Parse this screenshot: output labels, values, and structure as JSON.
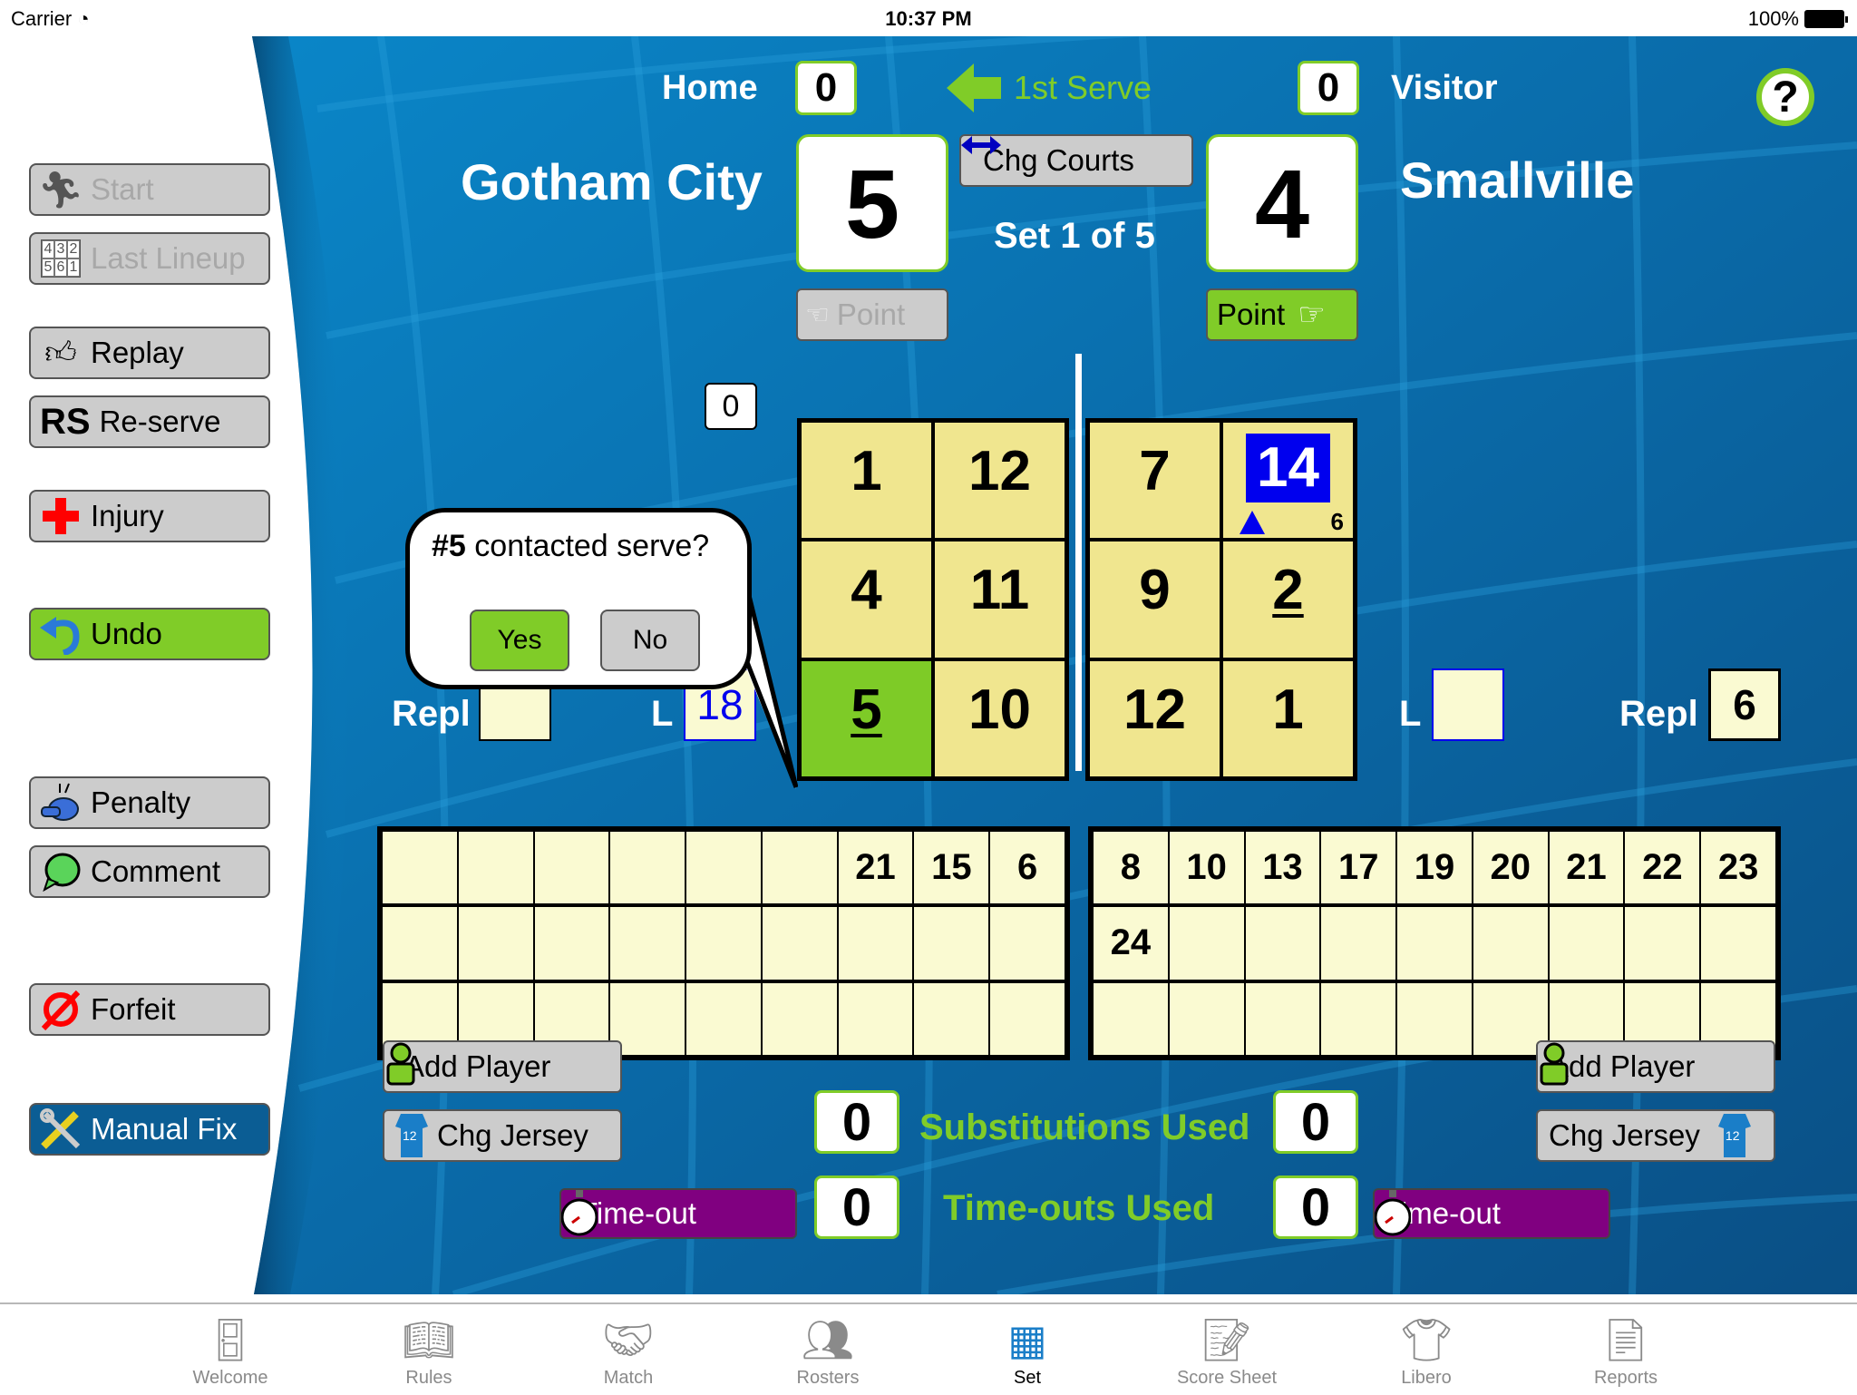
{
  "status_bar": {
    "carrier": "Carrier",
    "time": "10:37 PM",
    "battery": "100%"
  },
  "sidebar": {
    "start": "Start",
    "last_lineup": "Last Lineup",
    "last_lineup_icon_digits": [
      "4",
      "3",
      "2",
      "5",
      "6",
      "1"
    ],
    "replay": "Replay",
    "reserve_icon": "RS",
    "reserve": "Re-serve",
    "injury": "Injury",
    "undo": "Undo",
    "penalty": "Penalty",
    "comment": "Comment",
    "forfeit": "Forfeit",
    "manual_fix": "Manual Fix"
  },
  "header": {
    "home_label": "Home",
    "home_sets": "0",
    "visitor_label": "Visitor",
    "visitor_sets": "0",
    "first_serve": "1st Serve",
    "help": "?",
    "home_team": "Gotham City",
    "visitor_team": "Smallville",
    "home_score": "5",
    "visitor_score": "4",
    "change_courts": "Chg Courts",
    "set_info": "Set 1 of 5",
    "home_point": "Point",
    "visitor_point": "Point"
  },
  "home_court": {
    "serve_counter": "0",
    "cells": [
      "1",
      "12",
      "4",
      "11",
      "5",
      "10"
    ],
    "repl_label": "Repl",
    "repl_value": "",
    "libero_label": "L",
    "libero_value": "18"
  },
  "visitor_court": {
    "cells": [
      "7",
      "14",
      "9",
      "2",
      "12",
      "1"
    ],
    "highlight_sub": "6",
    "repl_label": "Repl",
    "repl_value": "6",
    "libero_label": "L",
    "libero_value": ""
  },
  "popup": {
    "prefix": "#5",
    "question": "contacted serve?",
    "yes": "Yes",
    "no": "No"
  },
  "home_bench": [
    "",
    "",
    "",
    "",
    "",
    "",
    "21",
    "15",
    "6",
    "",
    "",
    "",
    "",
    "",
    "",
    "",
    "",
    "",
    "",
    "",
    "",
    "",
    "",
    "",
    "",
    "",
    ""
  ],
  "visitor_bench": [
    "8",
    "10",
    "13",
    "17",
    "19",
    "20",
    "21",
    "22",
    "23",
    "24",
    "",
    "",
    "",
    "",
    "",
    "",
    "",
    "",
    "",
    "",
    "",
    "",
    "",
    "",
    "",
    "",
    ""
  ],
  "bottom": {
    "add_player": "Add Player",
    "chg_jersey": "Chg Jersey",
    "jersey_number": "12",
    "subs_label": "Substitutions Used",
    "home_subs": "0",
    "visitor_subs": "0",
    "timeouts_label": "Time-outs Used",
    "home_timeouts": "0",
    "visitor_timeouts": "0",
    "timeout": "Time-out"
  },
  "tabs": [
    {
      "label": "Welcome",
      "icon": "door-icon"
    },
    {
      "label": "Rules",
      "icon": "book-icon"
    },
    {
      "label": "Match",
      "icon": "handshake-icon"
    },
    {
      "label": "Rosters",
      "icon": "people-icon"
    },
    {
      "label": "Set",
      "icon": "volleyball-net-icon",
      "active": true
    },
    {
      "label": "Score Sheet",
      "icon": "score-sheet-icon"
    },
    {
      "label": "Libero",
      "icon": "libero-shirt-icon"
    },
    {
      "label": "Reports",
      "icon": "report-icon"
    }
  ],
  "colors": {
    "accent_green": "#80cc28",
    "panel_blue": "#0a6aa8",
    "timeout_purple": "#800080",
    "highlight_blue": "#0000ee",
    "court_yellow": "#f0e68f"
  }
}
